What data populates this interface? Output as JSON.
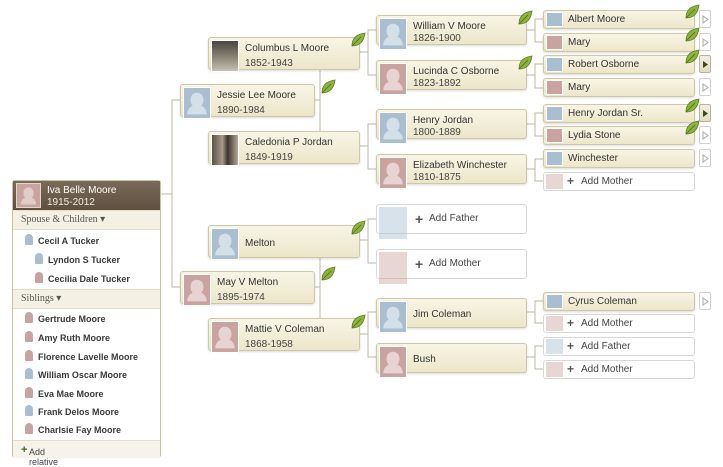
{
  "focus": {
    "name": "Iva Belle Moore",
    "dates": "1915-2012",
    "spouse_section_label": "Spouse & Children ▾",
    "spouse": "Cecil A Tucker",
    "children": [
      "Lyndon S Tucker",
      "Cecilia Dale Tucker"
    ],
    "siblings_section_label": "Siblings ▾",
    "siblings": [
      {
        "name": "Gertrude Moore",
        "gender": "female"
      },
      {
        "name": "Amy Ruth Moore",
        "gender": "female"
      },
      {
        "name": "Florence Lavelle Moore",
        "gender": "female"
      },
      {
        "name": "William Oscar Moore",
        "gender": "male"
      },
      {
        "name": "Eva Mae Moore",
        "gender": "female"
      },
      {
        "name": "Frank Delos Moore",
        "gender": "male"
      },
      {
        "name": "Charlsie Fay Moore",
        "gender": "female"
      }
    ],
    "add_relative_label": "Add relative"
  },
  "tree": {
    "father": {
      "name": "Jessie Lee Moore",
      "dates": "1890-1984"
    },
    "mother": {
      "name": "May V Melton",
      "dates": "1895-1974"
    },
    "pgf": {
      "name": "Columbus L Moore",
      "dates": "1852-1943"
    },
    "pgm": {
      "name": "Caledonia P Jordan",
      "dates": "1849-1919"
    },
    "mgf": {
      "name": "Melton",
      "dates": ""
    },
    "mgm": {
      "name": "Mattie V Coleman",
      "dates": "1868-1958"
    },
    "ggp": [
      {
        "name": "William V Moore",
        "dates": "1826-1900"
      },
      {
        "name": "Lucinda C Osborne",
        "dates": "1823-1892"
      },
      {
        "name": "Henry Jordan",
        "dates": "1800-1889"
      },
      {
        "name": "Elizabeth Winchester",
        "dates": "1810-1875"
      },
      {
        "name": "Jim Coleman",
        "dates": ""
      },
      {
        "name": "Bush",
        "dates": ""
      }
    ],
    "gggp": [
      "Albert Moore",
      "Mary",
      "Robert Osborne",
      "Mary",
      "Henry Jordan Sr.",
      "Lydia Stone",
      "Winchester",
      "Cyrus Coleman"
    ],
    "add_father": "Add Father",
    "add_mother": "Add Mother"
  },
  "colors": {
    "card_top": "#f8f5e6",
    "card_bottom": "#ece6c9",
    "card_border": "#cfc8a8",
    "male_photo": "#a9bfd0",
    "female_photo": "#c9a3a0",
    "focus_header": "#6b5b4a",
    "leaf_hint": "#8cb43c",
    "connector": "#bdb7a0"
  },
  "icons": [
    "leaf-hint-icon",
    "male-silhouette-icon",
    "female-silhouette-icon",
    "expand-arrow-icon",
    "plus-icon"
  ]
}
